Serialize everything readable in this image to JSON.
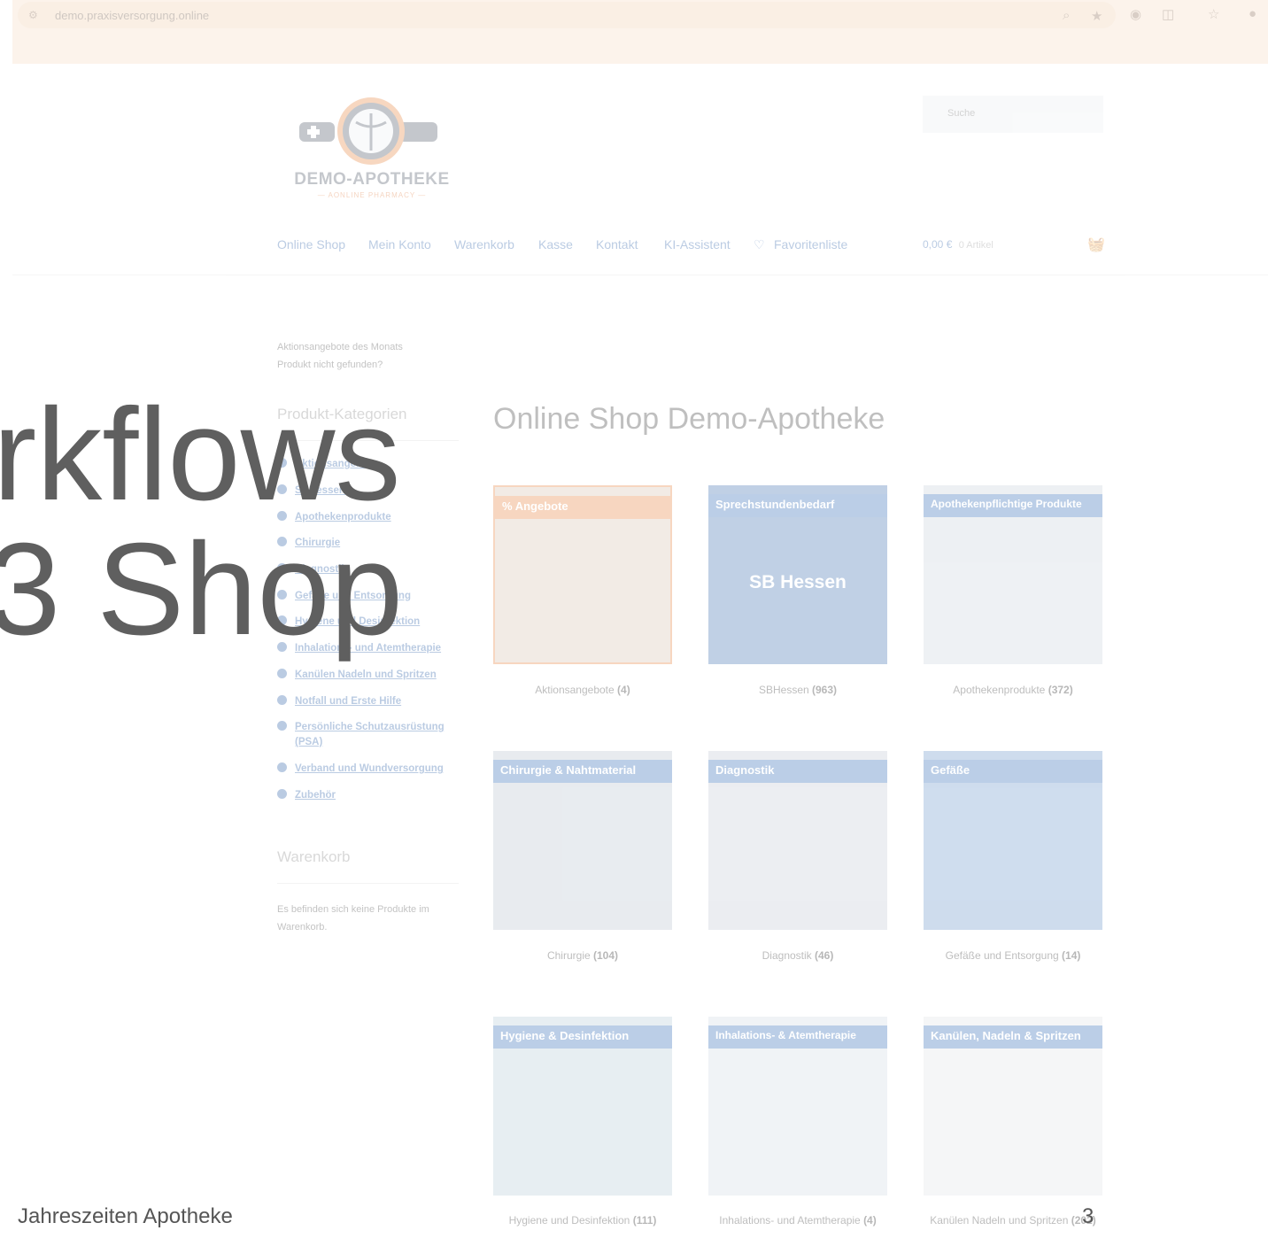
{
  "browser": {
    "url": "demo.praxisversorgung.online"
  },
  "logo": {
    "name": "DEMO-APOTHEKE",
    "tagline": "— AONLINE PHARMACY —"
  },
  "search": {
    "placeholder": "Suche"
  },
  "nav": {
    "items": [
      "Online Shop",
      "Mein Konto",
      "Warenkorb",
      "Kasse",
      "Kontakt",
      "KI-Assistent",
      "Favoritenliste"
    ]
  },
  "cart": {
    "total": "0,00 €",
    "count": "0 Artikel"
  },
  "promo_links": [
    "Aktionsangebote des Monats",
    "Produkt nicht gefunden?"
  ],
  "sidebar": {
    "categories_heading": "Produkt-Kategorien",
    "categories": [
      "Aktionsangebote",
      "SBHessen",
      "Apothekenprodukte",
      "Chirurgie",
      "Diagnostik",
      "Gefäße und Entsorgung",
      "Hygiene und Desinfektion",
      "Inhalations- und Atemtherapie",
      "Kanülen Nadeln und Spritzen",
      "Notfall und Erste Hilfe",
      "Persönliche Schutzausrüstung",
      "(PSA)",
      "Verband und Wundversorgung",
      "Zubehör"
    ],
    "cart_heading": "Warenkorb",
    "cart_empty": "Es befinden sich keine Produkte im Warenkorb."
  },
  "main": {
    "title": "Online Shop Demo-Apotheke",
    "tiles": [
      {
        "band": "% Angebote",
        "center": "",
        "name": "Aktionsangebote",
        "count": "(4)",
        "color": "#e8823e"
      },
      {
        "band": "Sprechstundenbedarf",
        "center": "SB Hessen",
        "name": "SBHessen",
        "count": "(963)",
        "color": "#2e6ab5"
      },
      {
        "band": "Apothekenpflichtige Produkte",
        "center": "",
        "name": "Apothekenprodukte",
        "count": "(372)",
        "color": "#2e6ab5"
      },
      {
        "band": "Chirurgie & Nahtmaterial",
        "center": "",
        "name": "Chirurgie",
        "count": "(104)",
        "color": "#2e6ab5"
      },
      {
        "band": "Diagnostik",
        "center": "",
        "name": "Diagnostik",
        "count": "(46)",
        "color": "#2e6ab5"
      },
      {
        "band": "Gefäße",
        "center": "",
        "name": "Gefäße und Entsorgung",
        "count": "(14)",
        "color": "#2e6ab5"
      },
      {
        "band": "Hygiene & Desinfektion",
        "center": "",
        "name": "Hygiene und Desinfektion",
        "count": "(111)",
        "color": "#2e6ab5"
      },
      {
        "band": "Inhalations- & Atemtherapie",
        "center": "",
        "name": "Inhalations- und Atemtherapie",
        "count": "(4)",
        "color": "#2e6ab5"
      },
      {
        "band": "Kanülen, Nadeln & Spritzen",
        "center": "",
        "name": "Kanülen Nadeln und Spritzen",
        "count": "(202)",
        "color": "#2e6ab5"
      }
    ]
  },
  "overlay": {
    "title_line1": "rkflows",
    "title_line2": "3 Shop",
    "footer": "Jahreszeiten Apotheke",
    "page_number": "3"
  },
  "colors": {
    "accent": "#2b5fa8",
    "orange": "#e8823e",
    "tile_blue": "#2e6ab5"
  }
}
